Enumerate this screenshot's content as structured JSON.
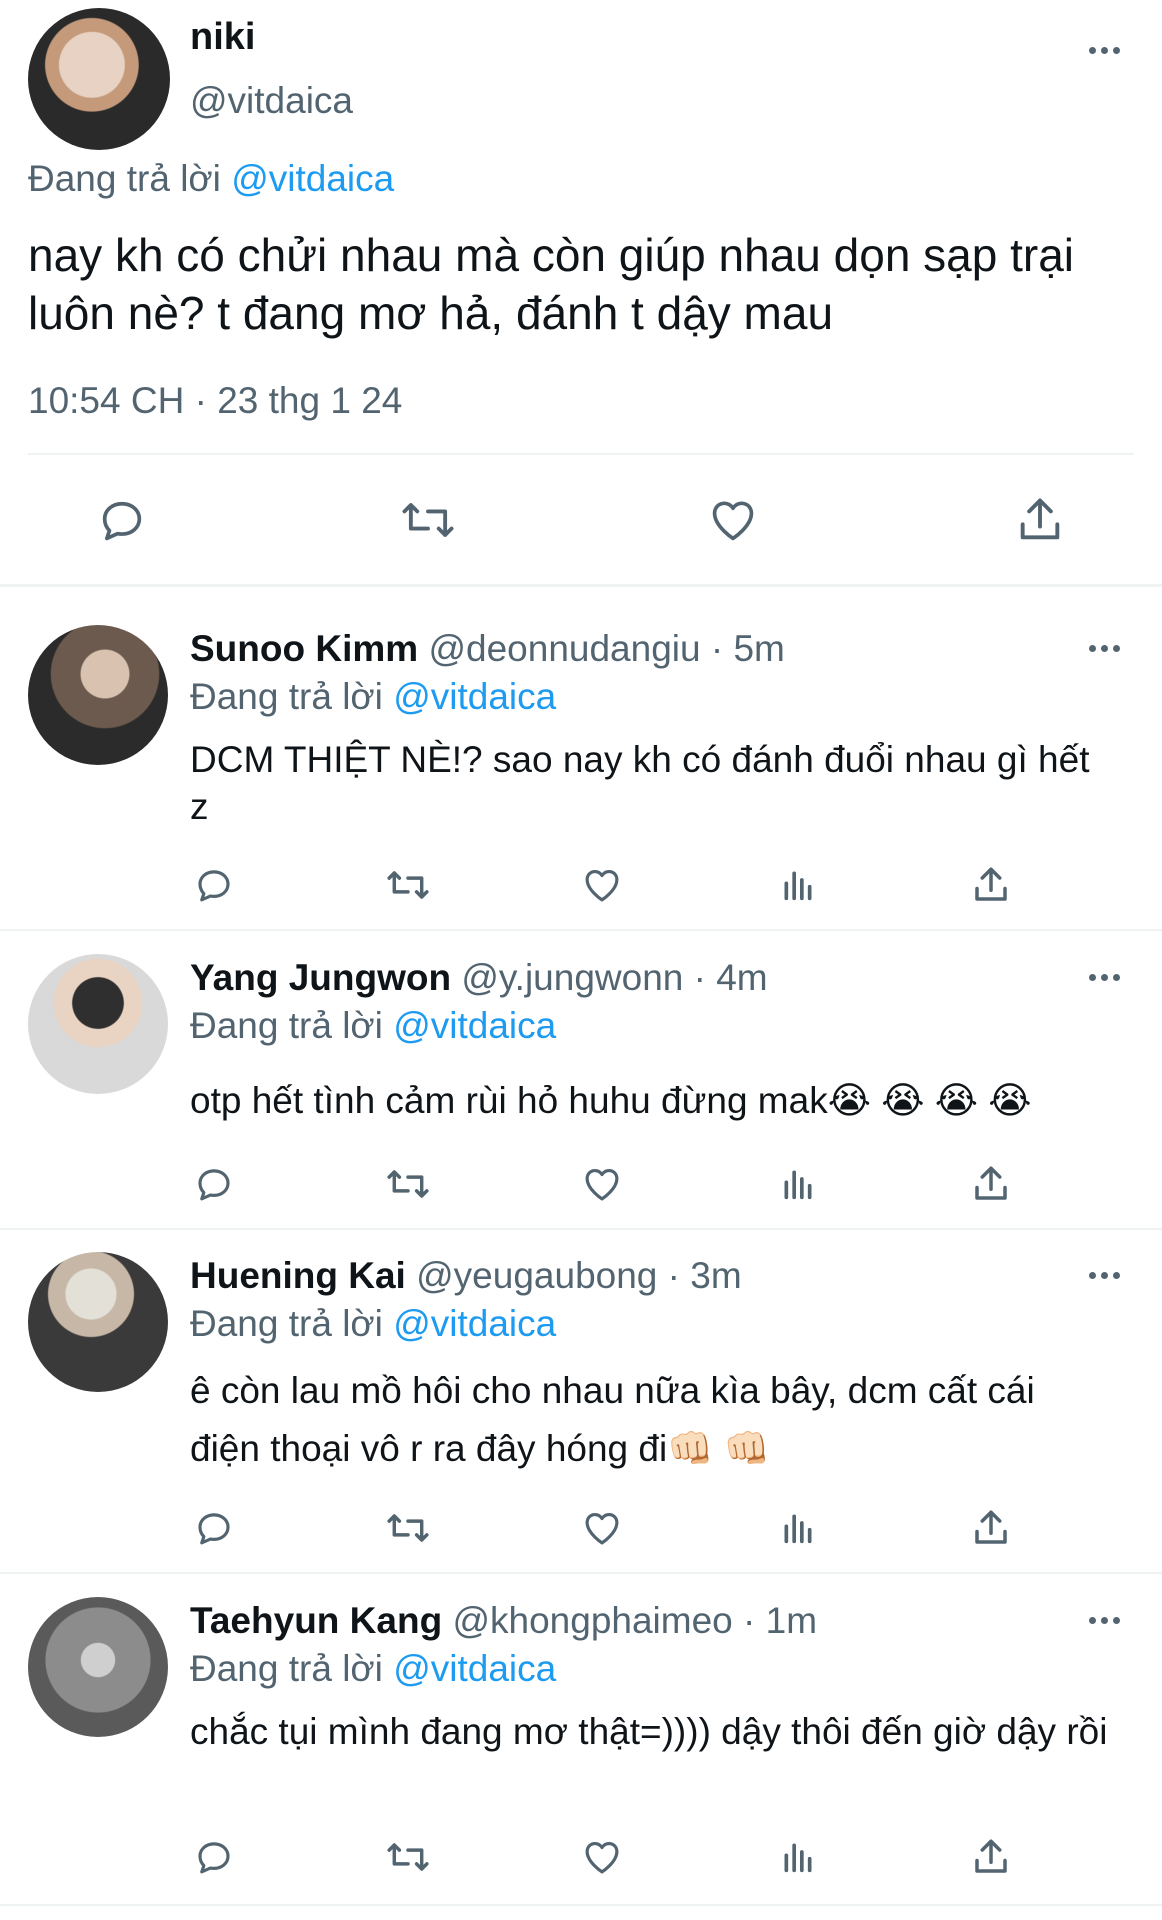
{
  "main_tweet": {
    "name": "niki",
    "handle": "@vitdaica",
    "replying_prefix": "Đang trả lời",
    "replying_to": "@vitdaica",
    "text": "nay kh có chửi nhau mà còn giúp nhau dọn sạp trại luôn nè? t đang mơ hả, đánh t dậy mau",
    "timestamp": "10:54 CH · 23 thg 1 24",
    "actions": [
      "reply-icon",
      "retweet-icon",
      "like-icon",
      "share-icon"
    ]
  },
  "replies": [
    {
      "name": "Sunoo Kimm",
      "handle": "@deonnudangiu",
      "time": "· 5m",
      "replying_prefix": "Đang trả lời",
      "replying_to": "@vitdaica",
      "text": "DCM THIỆT NÈ!? sao nay kh có đánh đuổi nhau gì hết z"
    },
    {
      "name": "Yang Jungwon",
      "handle": "@y.jungwonn",
      "time": "· 4m",
      "replying_prefix": "Đang trả lời",
      "replying_to": "@vitdaica",
      "text": "otp hết tình cảm rùi hỏ huhu đừng mak😭 😭 😭 😭"
    },
    {
      "name": "Huening Kai",
      "handle": "@yeugaubong",
      "time": "· 3m",
      "replying_prefix": "Đang trả lời",
      "replying_to": "@vitdaica",
      "text": "ê còn lau mồ hôi cho nhau nữa kìa bây, dcm cất cái điện thoại vô r ra đây hóng đi👊🏻 👊🏻"
    },
    {
      "name": "Taehyun Kang",
      "handle": "@khongphaimeo",
      "time": "· 1m",
      "replying_prefix": "Đang trả lời",
      "replying_to": "@vitdaica",
      "text": "chắc tụi mình đang mơ thật=)))) dậy thôi đến giờ dậy rồi"
    }
  ],
  "colors": {
    "link": "#1d9bf0",
    "muted": "#536471",
    "text": "#0f1419",
    "divider": "#eff3f4"
  }
}
